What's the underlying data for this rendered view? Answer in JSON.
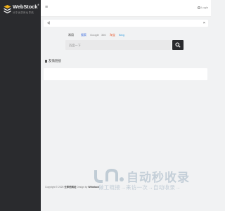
{
  "brand": {
    "name": "WebStock",
    "mark": "®",
    "tagline": "分享优质网址导航"
  },
  "topbar": {
    "menu_icon": "hamburger-icon",
    "login_label": "Login"
  },
  "notice": {
    "icon": "volume-icon",
    "close_label": "×"
  },
  "search": {
    "tabs": [
      {
        "label": "常用",
        "color": "#666666"
      },
      {
        "label": "搜索",
        "color": "#3b6be0"
      },
      {
        "label": "Google",
        "color": "#888888"
      },
      {
        "label": "360",
        "color": "#888888"
      },
      {
        "label": "淘宝",
        "color": "#e8552a"
      },
      {
        "label": "Bing",
        "color": "#3ba2e0"
      }
    ],
    "placeholder": "百度一下",
    "button_icon": "search-icon"
  },
  "section": {
    "title": "友情链接",
    "icon": "tag-icon"
  },
  "footer": {
    "copyright": "Copyright © 2025 ",
    "site": "云享优网址",
    "design_prefix": " Design by ",
    "designer": "Webstack"
  },
  "watermark": {
    "title": "自动秒收录",
    "subtitle": "做工链接→来访一次→自动收录→",
    "color": "#8fa5b8"
  }
}
